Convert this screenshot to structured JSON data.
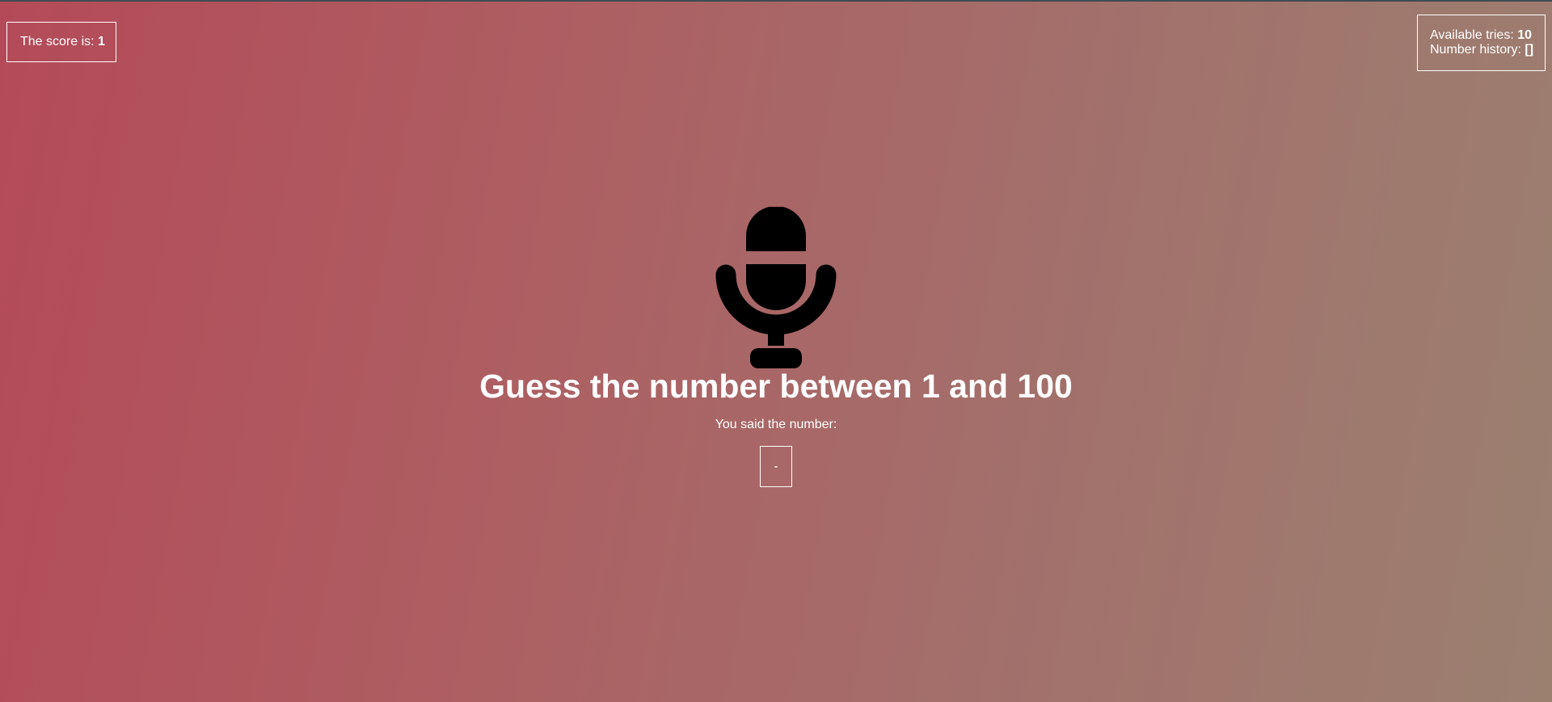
{
  "score": {
    "label": "The score is: ",
    "value": "1"
  },
  "stats": {
    "tries_label": "Available tries: ",
    "tries_value": "10",
    "history_label": "Number history: ",
    "history_value": "[]"
  },
  "icon": "microphone-icon",
  "main": {
    "title": "Guess the number between 1 and 100",
    "said_label": "You said the number:",
    "said_value": "-"
  },
  "colors": {
    "gradient_left": "#b44a58",
    "gradient_right": "#9b8070",
    "text": "#ffffff",
    "icon": "#000000"
  }
}
